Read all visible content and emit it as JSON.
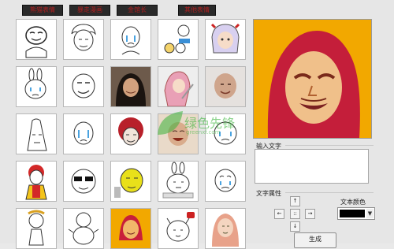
{
  "window": {
    "tabs": [
      {
        "label": "熊猫表情"
      },
      {
        "label": "暴走漫画"
      },
      {
        "label": "金馆长"
      },
      {
        "label": "其他表情"
      }
    ]
  },
  "grid": {
    "columns": 5,
    "rows": 5,
    "cells": [
      {
        "icon": "rage-face-icon"
      },
      {
        "icon": "curly-hair-face-icon"
      },
      {
        "icon": "crying-face-icon"
      },
      {
        "icon": "cartoon-crowd-icon"
      },
      {
        "icon": "anime-girl-icon"
      },
      {
        "icon": "rabbit-face-icon"
      },
      {
        "icon": "smirk-face-icon"
      },
      {
        "icon": "long-hair-man-photo-icon"
      },
      {
        "icon": "pink-hair-girl-icon"
      },
      {
        "icon": "bald-man-photo-icon"
      },
      {
        "icon": "long-face-icon"
      },
      {
        "icon": "teary-face-icon"
      },
      {
        "icon": "red-afro-face-icon"
      },
      {
        "icon": "laughing-photo-icon"
      },
      {
        "icon": "cold-face-icon"
      },
      {
        "icon": "clown-icon"
      },
      {
        "icon": "sunglasses-face-icon"
      },
      {
        "icon": "yellow-face-icon"
      },
      {
        "icon": "bunny-thinking-icon"
      },
      {
        "icon": "worried-face-icon"
      },
      {
        "icon": "small-doll-icon"
      },
      {
        "icon": "chubby-figure-icon"
      },
      {
        "icon": "portrait-face-icon"
      },
      {
        "icon": "cat-face-icon"
      },
      {
        "icon": "long-hair-girl-icon"
      }
    ]
  },
  "preview": {
    "icon": "preview-portrait-icon"
  },
  "text_input": {
    "label": "输入文字",
    "value": ""
  },
  "text_props": {
    "label": "文字属性"
  },
  "text_color": {
    "label": "文本颜色",
    "value_color": "#000000"
  },
  "arrows": {
    "up": "↑",
    "down": "↓",
    "left": "←",
    "right": "→",
    "center": "::"
  },
  "generate_button": {
    "label": "生成"
  },
  "watermark": {
    "text": "绿色先锋",
    "sub": "greenxf.com"
  }
}
